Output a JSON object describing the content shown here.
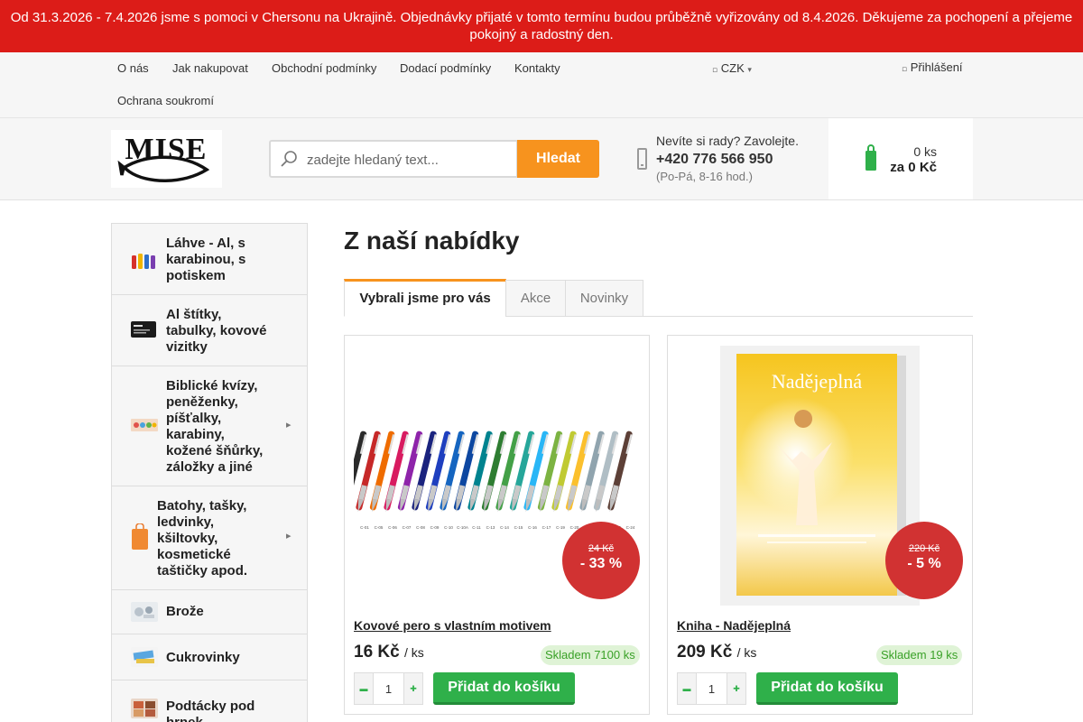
{
  "announcement": {
    "line1": "Od 31.3.2026 - 7.4.2026 jsme s pomoci v Chersonu na Ukrajině. Objednávky přijaté v tomto termínu budou průběžně vyřizovány od 8.4.2026. Děkujeme za pochopení a přejeme",
    "line2": "pokojný a radostný den."
  },
  "topnav": {
    "links": [
      "O nás",
      "Jak nakupovat",
      "Obchodní podmínky",
      "Dodací podmínky",
      "Kontakty",
      "Ochrana soukromí"
    ],
    "currency": "CZK",
    "login": "Přihlášení"
  },
  "header": {
    "logo_text": "MISE",
    "search_placeholder": "zadejte hledaný text...",
    "search_button": "Hledat",
    "help_question": "Nevíte si rady? Zavolejte.",
    "phone": "+420 776 566 950",
    "hours": "(Po-Pá, 8-16 hod.)",
    "cart_count": "0 ks",
    "cart_total": "za 0 Kč"
  },
  "sidebar": {
    "categories": [
      {
        "label": "Láhve - Al, s karabinou, s potiskem",
        "has_sub": false
      },
      {
        "label": "Al štítky, tabulky, kovové vizitky",
        "has_sub": false
      },
      {
        "label": "Biblické kvízy, peněženky, píšťalky, karabiny, kožené šňůrky, záložky a jiné",
        "has_sub": true
      },
      {
        "label": "Batohy, tašky, ledvinky, kšiltovky, kosmetické taštičky apod.",
        "has_sub": true
      },
      {
        "label": "Brože",
        "has_sub": false
      },
      {
        "label": "Cukrovinky",
        "has_sub": false
      },
      {
        "label": "Podtácky pod hrnek",
        "has_sub": false
      }
    ]
  },
  "main": {
    "title": "Z naší nabídky",
    "tabs": [
      "Vybrali jsme pro vás",
      "Akce",
      "Novinky"
    ],
    "active_tab": 0
  },
  "products": [
    {
      "name": "Kovové pero s vlastním motivem",
      "price": "16 Kč",
      "unit": "/ ks",
      "old_price": "24 Kč",
      "discount": "- 33 %",
      "stock": "Skladem 7100 ks",
      "qty": "1",
      "add_label": "Přidat do košíku",
      "image": "pens-icon",
      "pen_codes": [
        "C-01",
        "C-05",
        "C-06",
        "C-07",
        "C-08",
        "C-09",
        "C-10",
        "C-10A",
        "C-11",
        "C-13",
        "C-14",
        "C-15",
        "C-16",
        "C-17",
        "C-19",
        "C-20",
        "C-21",
        "C-22",
        "C-23",
        "C-24"
      ]
    },
    {
      "name": "Kniha - Nadějeplná",
      "price": "209 Kč",
      "unit": "/ ks",
      "old_price": "220 Kč",
      "discount": "- 5 %",
      "stock": "Skladem 19 ks",
      "qty": "1",
      "add_label": "Přidat do košíku",
      "image": "book-cover",
      "cover_title": "Nadějeplná"
    }
  ],
  "colors": {
    "announce": "#dc1c18",
    "accent": "#f7931e",
    "green": "#2fb04a",
    "discount": "#d13232"
  }
}
